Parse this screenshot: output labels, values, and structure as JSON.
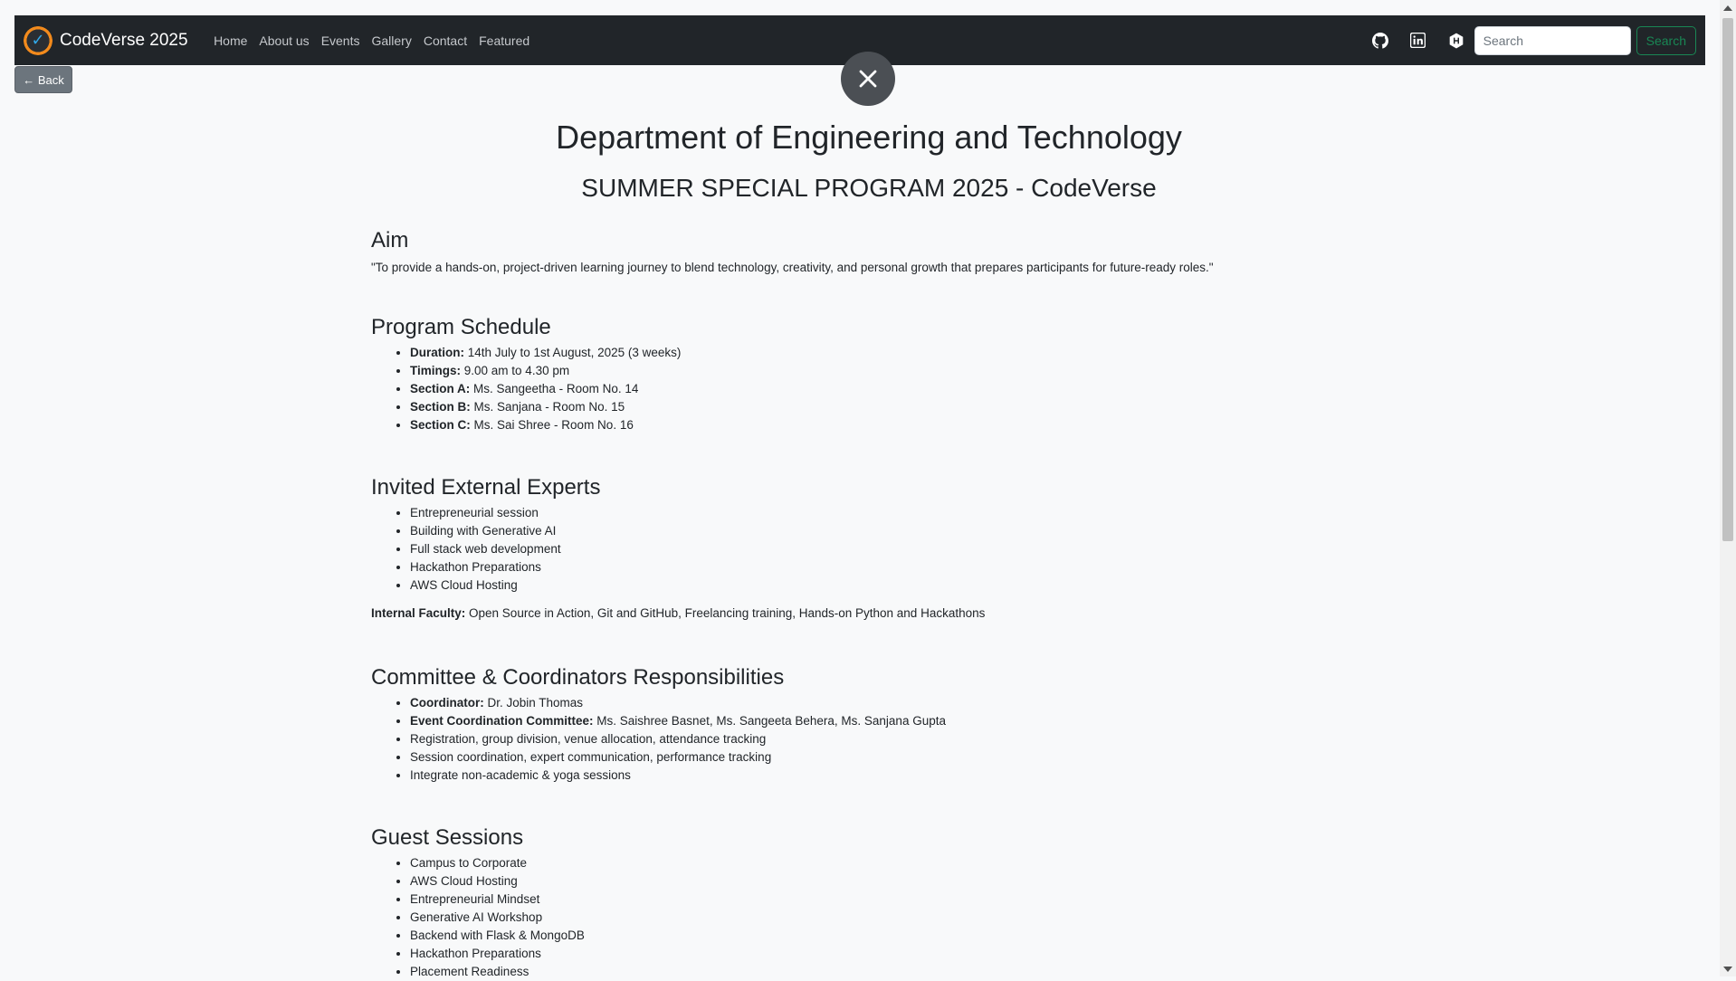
{
  "navbar": {
    "brand": "CodeVerse 2025",
    "links": [
      "Home",
      "About us",
      "Events",
      "Gallery",
      "Contact",
      "Featured"
    ],
    "search_placeholder": "Search",
    "search_button": "Search"
  },
  "back_button": "← Back",
  "close_symbol": "✕",
  "header": {
    "department": "Department of Engineering and Technology",
    "program": "SUMMER SPECIAL PROGRAM 2025 - CodeVerse"
  },
  "aim": {
    "heading": "Aim",
    "text": "\"To provide a hands-on, project-driven learning journey to blend technology, creativity, and personal growth that prepares participants for future-ready roles.\""
  },
  "schedule": {
    "heading": "Program Schedule",
    "items": [
      {
        "label": "Duration:",
        "value": " 14th July to 1st August, 2025 (3 weeks)"
      },
      {
        "label": "Timings:",
        "value": " 9.00 am to 4.30 pm"
      },
      {
        "label": "Section A:",
        "value": " Ms. Sangeetha - Room No. 14"
      },
      {
        "label": "Section B:",
        "value": " Ms. Sanjana - Room No. 15"
      },
      {
        "label": "Section C:",
        "value": " Ms. Sai Shree - Room No. 16"
      }
    ]
  },
  "experts": {
    "heading": "Invited External Experts",
    "items": [
      "Entrepreneurial session",
      "Building with Generative AI",
      "Full stack web development",
      "Hackathon Preparations",
      "AWS Cloud Hosting"
    ],
    "internal_label": "Internal Faculty:",
    "internal_value": " Open Source in Action, Git and GitHub, Freelancing training, Hands-on Python and Hackathons"
  },
  "committee": {
    "heading": "Committee & Coordinators Responsibilities",
    "coordinator_label": "Coordinator:",
    "coordinator_value": " Dr. Jobin Thomas",
    "committee_label": "Event Coordination Committee:",
    "committee_value": " Ms. Saishree Basnet, Ms. Sangeeta Behera, Ms. Sanjana Gupta",
    "items": [
      "Registration, group division, venue allocation, attendance tracking",
      "Session coordination, expert communication, performance tracking",
      "Integrate non-academic & yoga sessions"
    ]
  },
  "guest": {
    "heading": "Guest Sessions",
    "items": [
      "Campus to Corporate",
      "AWS Cloud Hosting",
      "Entrepreneurial Mindset",
      "Generative AI Workshop",
      "Backend with Flask & MongoDB",
      "Hackathon Preparations",
      "Placement Readiness"
    ]
  },
  "icons": [
    "github-icon",
    "linkedin-icon",
    "hackerrank-icon",
    "close-icon"
  ],
  "colors": {
    "navbar": "#212529",
    "search_button": "#198754",
    "back_button": "#6c757d",
    "close_button": "#4b4f54"
  }
}
